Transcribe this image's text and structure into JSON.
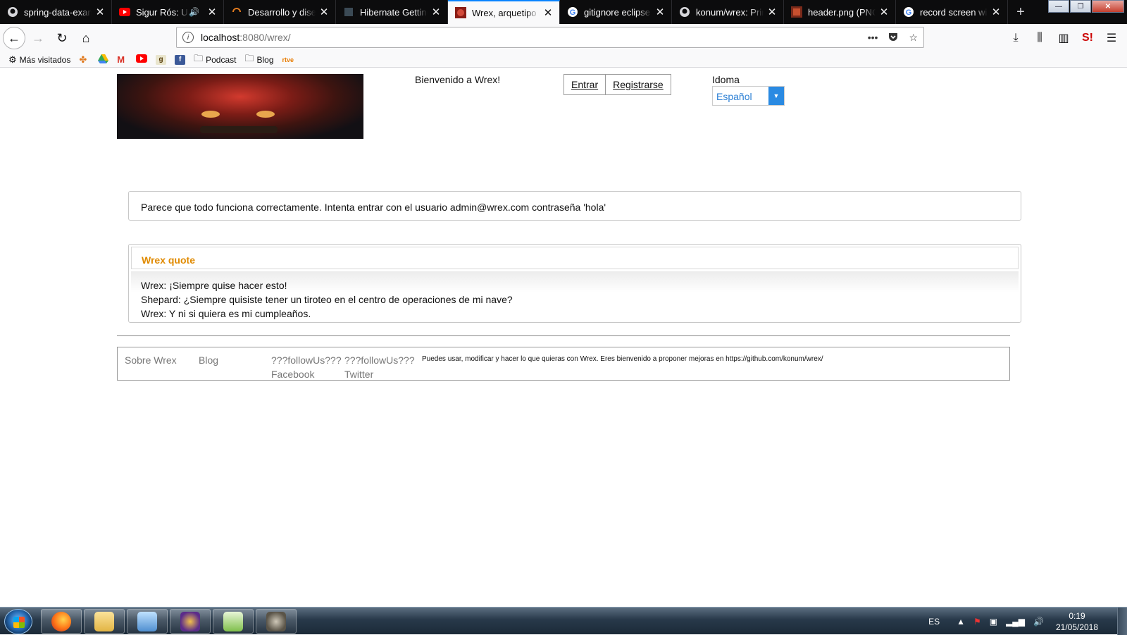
{
  "browser": {
    "tabs": [
      {
        "title": "spring-data-example",
        "active": false,
        "fav": "github-icon"
      },
      {
        "title": "Sigur Rós: Untitled",
        "active": false,
        "fav": "youtube-icon",
        "sound": true
      },
      {
        "title": "Desarrollo y diseño",
        "active": false,
        "fav": "spinner-icon"
      },
      {
        "title": "Hibernate Getting",
        "active": false,
        "fav": "hibernate-icon"
      },
      {
        "title": "Wrex, arquetipo JSF",
        "active": true,
        "fav": "wrex-icon"
      },
      {
        "title": "gitignore eclipse fi",
        "active": false,
        "fav": "google-icon"
      },
      {
        "title": "konum/wrex: Prim",
        "active": false,
        "fav": "github-icon"
      },
      {
        "title": "header.png (PNG I",
        "active": false,
        "fav": "image-icon"
      },
      {
        "title": "record screen wind",
        "active": false,
        "fav": "google-icon"
      }
    ],
    "url_host": "localhost",
    "url_rest": ":8080/wrex/",
    "bookmarks": [
      {
        "label": "Más visitados",
        "icon": "gear-icon"
      },
      {
        "label": "",
        "icon": "pinwheel-icon"
      },
      {
        "label": "",
        "icon": "drive-icon"
      },
      {
        "label": "",
        "icon": "gmail-icon"
      },
      {
        "label": "",
        "icon": "youtube-icon"
      },
      {
        "label": "",
        "icon": "goodreads-icon"
      },
      {
        "label": "",
        "icon": "facebook-icon"
      },
      {
        "label": "Podcast",
        "icon": "folder-icon"
      },
      {
        "label": "Blog",
        "icon": "folder-icon"
      },
      {
        "label": "rtve",
        "icon": "rtve-icon"
      }
    ]
  },
  "page": {
    "welcome": "Bienvenido a Wrex!",
    "login_label": "Entrar",
    "register_label": "Registrarse",
    "language_label": "Idoma",
    "language_value": "Español",
    "notice": "Parece que todo funciona correctamente. Intenta entrar con el usuario admin@wrex.com contraseña 'hola'",
    "quote_title": "Wrex quote",
    "quote_lines": [
      "Wrex: ¡Siempre quise hacer esto!",
      "Shepard: ¿Siempre quisiste tener un tiroteo en el centro de operaciones de mi nave?",
      "Wrex: Y ni si quiera es mi cumpleaños."
    ],
    "footer": {
      "about": "Sobre Wrex",
      "blog": "Blog",
      "follow1_top": "???followUs???",
      "follow1_bottom": "Facebook",
      "follow2_top": "???followUs???",
      "follow2_bottom": "Twitter",
      "note": "Puedes usar, modificar y hacer lo que quieras con Wrex. Eres bienvenido a proponer mejoras en https://github.com/konum/wrex/"
    }
  },
  "taskbar": {
    "language": "ES",
    "time": "0:19",
    "date": "21/05/2018"
  },
  "colors": {
    "accent_tab": "#0a84ff",
    "quote_title": "#e08a00",
    "select_text": "#2b7fd4"
  }
}
